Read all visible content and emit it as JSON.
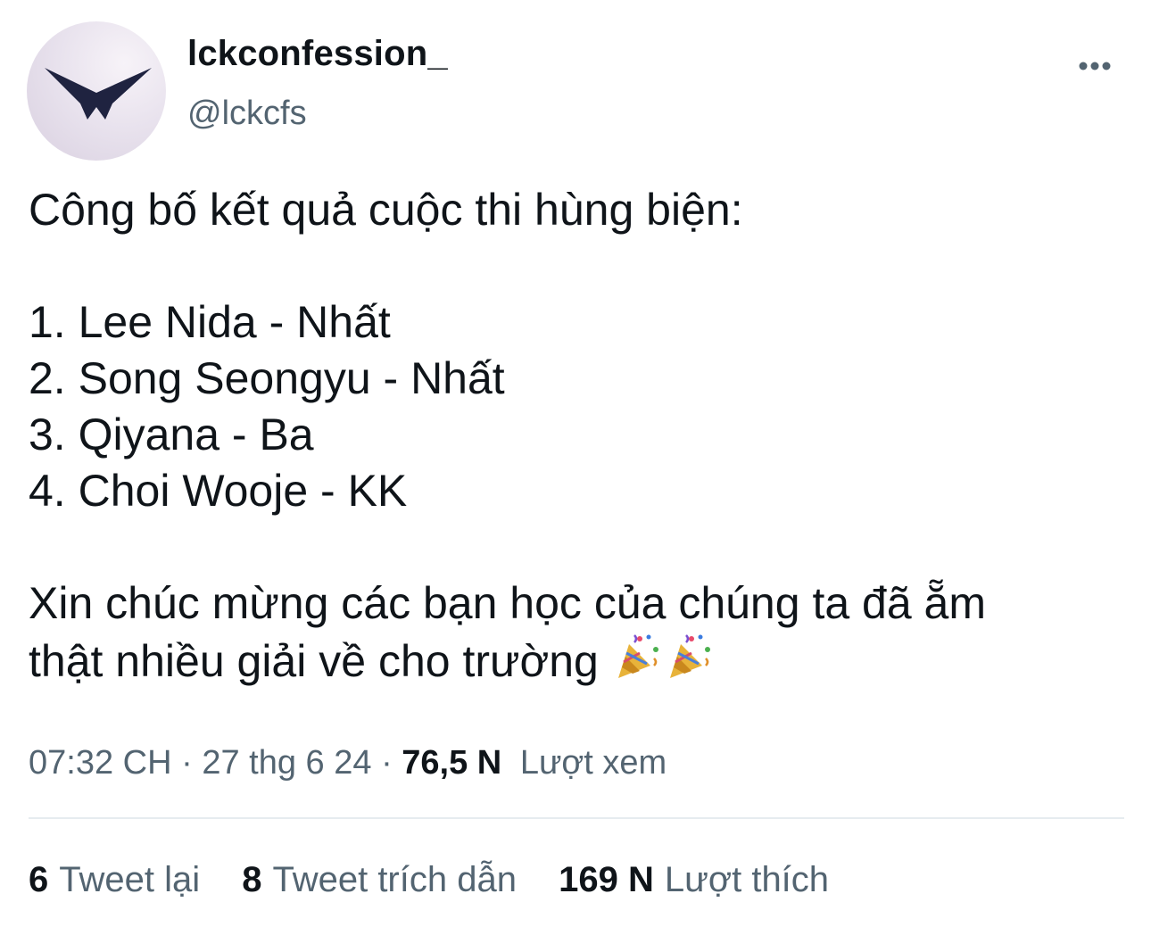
{
  "author": {
    "display_name": "lckconfession_",
    "handle": "@lckcfs",
    "avatar_icon": "bird-logo-icon"
  },
  "tweet": {
    "lines": [
      "Công bố kết quả cuộc thi hùng biện:",
      "",
      "1. Lee Nida - Nhất",
      "2. Song Seongyu - Nhất",
      "3. Qiyana - Ba",
      "4. Choi Wooje - KK",
      "",
      "Xin chúc mừng các bạn học của chúng ta đã ẵm",
      "thật nhiều giải về cho trường"
    ],
    "emojis": [
      "party-popper-icon",
      "party-popper-icon"
    ]
  },
  "meta": {
    "time": "07:32 CH",
    "separator": "·",
    "date": "27 thg 6 24",
    "views_count": "76,5 N",
    "views_label": "Lượt xem"
  },
  "stats": {
    "retweets_count": "6",
    "retweets_label": "Tweet lại",
    "quotes_count": "8",
    "quotes_label": "Tweet trích dẫn",
    "likes_count": "169 N",
    "likes_label": "Lượt thích"
  },
  "colors": {
    "text_primary": "#0f1419",
    "text_secondary": "#536471",
    "divider": "#e6ecf0",
    "logo": "#1f2340"
  }
}
